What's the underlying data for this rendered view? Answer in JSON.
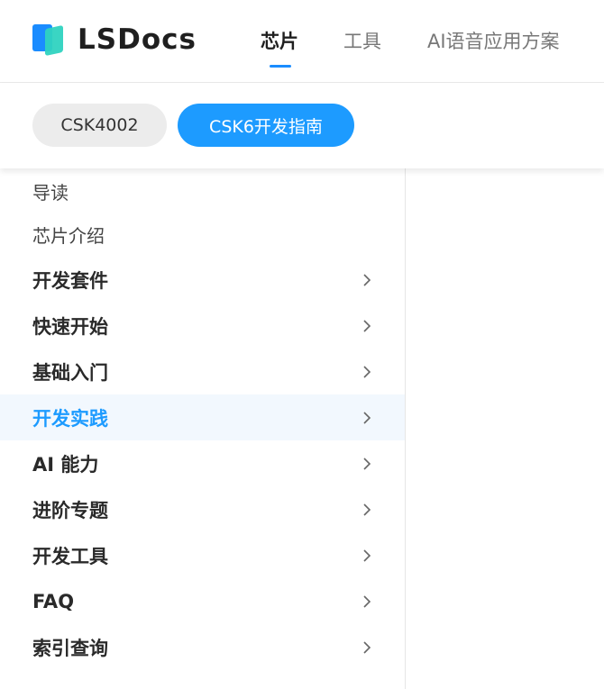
{
  "header": {
    "logo_text": "LSDocs",
    "nav": [
      {
        "label": "芯片",
        "active": true
      },
      {
        "label": "工具",
        "active": false
      },
      {
        "label": "AI语音应用方案",
        "active": false
      }
    ]
  },
  "chips": [
    {
      "label": "CSK4002",
      "active": false
    },
    {
      "label": "CSK6开发指南",
      "active": true
    }
  ],
  "sidebar": {
    "items": [
      {
        "label": "导读",
        "type": "plain"
      },
      {
        "label": "芯片介绍",
        "type": "plain"
      },
      {
        "label": "开发套件",
        "type": "group"
      },
      {
        "label": "快速开始",
        "type": "group"
      },
      {
        "label": "基础入门",
        "type": "group"
      },
      {
        "label": "开发实践",
        "type": "group",
        "selected": true
      },
      {
        "label": "AI 能力",
        "type": "group"
      },
      {
        "label": "进阶专题",
        "type": "group"
      },
      {
        "label": "开发工具",
        "type": "group"
      },
      {
        "label": "FAQ",
        "type": "group"
      },
      {
        "label": "索引查询",
        "type": "group"
      }
    ]
  },
  "colors": {
    "accent": "#1d9bff",
    "selected_bg": "#f2f8fe",
    "logo_blue": "#1a8cff",
    "logo_teal": "#2fd3c0"
  }
}
